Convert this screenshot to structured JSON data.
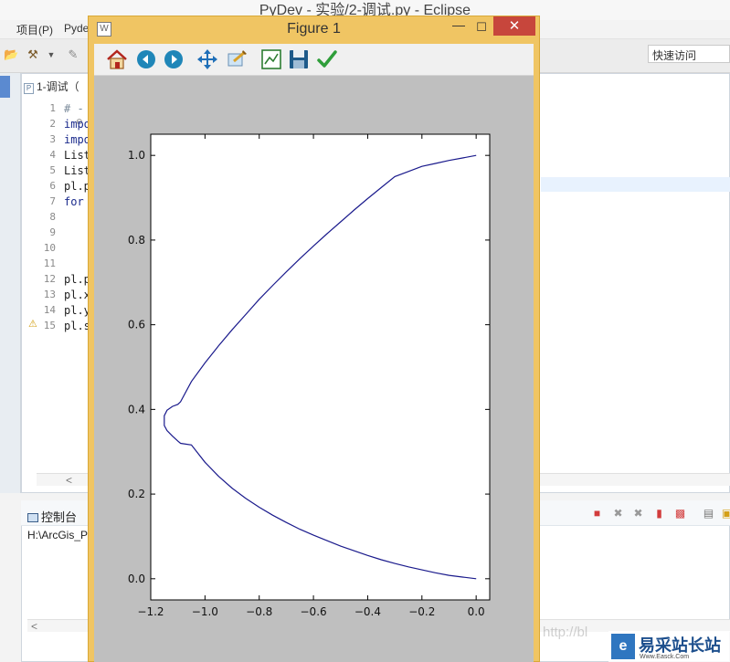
{
  "eclipse": {
    "title": "PyDev - 实验/2-调试.py - Eclipse",
    "menu": [
      "项目(P)",
      "Pyde"
    ],
    "quick_access": "快速访问",
    "editor_tab": "1-调试（",
    "line_numbers": [
      "1",
      "2",
      "3",
      "4",
      "5",
      "6",
      "7",
      "8",
      "9",
      "10",
      "11",
      "12",
      "13",
      "14",
      "15"
    ],
    "code_lines": [
      "# -",
      "impo",
      "impo",
      "List",
      "List",
      "pl.p",
      "for",
      "",
      "",
      "",
      "",
      "pl.p",
      "pl.x",
      "pl.y",
      "pl.s"
    ],
    "console_title": "控制台",
    "console_path": "H:\\ArcGis_P",
    "scroll_left": "<"
  },
  "figure": {
    "title": "Figure 1",
    "toolbar": [
      "home-icon",
      "back-icon",
      "forward-icon",
      "pan-icon",
      "zoom-icon",
      "subplots-icon",
      "save-icon",
      "edit-icon"
    ],
    "close": "✕",
    "minimize": "—",
    "maximize": "☐"
  },
  "chart_data": {
    "type": "line",
    "title": "",
    "xlabel": "",
    "ylabel": "",
    "xlim": [
      -1.2,
      0.05
    ],
    "ylim": [
      -0.05,
      1.05
    ],
    "xticks": [
      "−1.2",
      "−1.0",
      "−0.8",
      "−0.6",
      "−0.4",
      "−0.2",
      "0.0"
    ],
    "yticks": [
      "0.0",
      "0.2",
      "0.4",
      "0.6",
      "0.8",
      "1.0"
    ],
    "grid": false,
    "series": [
      {
        "color": "#1a1a8c",
        "x": [
          0.0,
          -0.05,
          -0.1,
          -0.15,
          -0.2,
          -0.25,
          -0.3,
          -0.35,
          -0.4,
          -0.45,
          -0.5,
          -0.55,
          -0.6,
          -0.65,
          -0.7,
          -0.75,
          -0.8,
          -0.85,
          -0.9,
          -0.95,
          -1.0,
          -1.05,
          -1.09,
          -1.1,
          -1.12,
          -1.14,
          -1.15,
          -1.15,
          -1.14,
          -1.12,
          -1.1,
          -1.09,
          -1.05,
          -1.0,
          -0.95,
          -0.9,
          -0.85,
          -0.8,
          -0.75,
          -0.7,
          -0.65,
          -0.6,
          -0.55,
          -0.5,
          -0.45,
          -0.4,
          -0.35,
          -0.3,
          -0.25,
          -0.2,
          -0.15,
          -0.1,
          -0.05,
          0.0
        ],
        "y": [
          0.0,
          0.004,
          0.008,
          0.014,
          0.021,
          0.028,
          0.036,
          0.045,
          0.055,
          0.066,
          0.077,
          0.09,
          0.103,
          0.117,
          0.133,
          0.15,
          0.169,
          0.19,
          0.214,
          0.242,
          0.275,
          0.316,
          0.32,
          0.325,
          0.337,
          0.35,
          0.362,
          0.385,
          0.398,
          0.407,
          0.412,
          0.418,
          0.466,
          0.51,
          0.55,
          0.588,
          0.624,
          0.66,
          0.693,
          0.725,
          0.756,
          0.786,
          0.815,
          0.843,
          0.871,
          0.898,
          0.924,
          0.95,
          0.962,
          0.974,
          0.981,
          0.988,
          0.994,
          1.0
        ]
      }
    ]
  },
  "watermark": {
    "brand": "易采站长站",
    "sub": "Www.Easck.Com",
    "logo_glyph": "e",
    "faint": "http://bl"
  }
}
